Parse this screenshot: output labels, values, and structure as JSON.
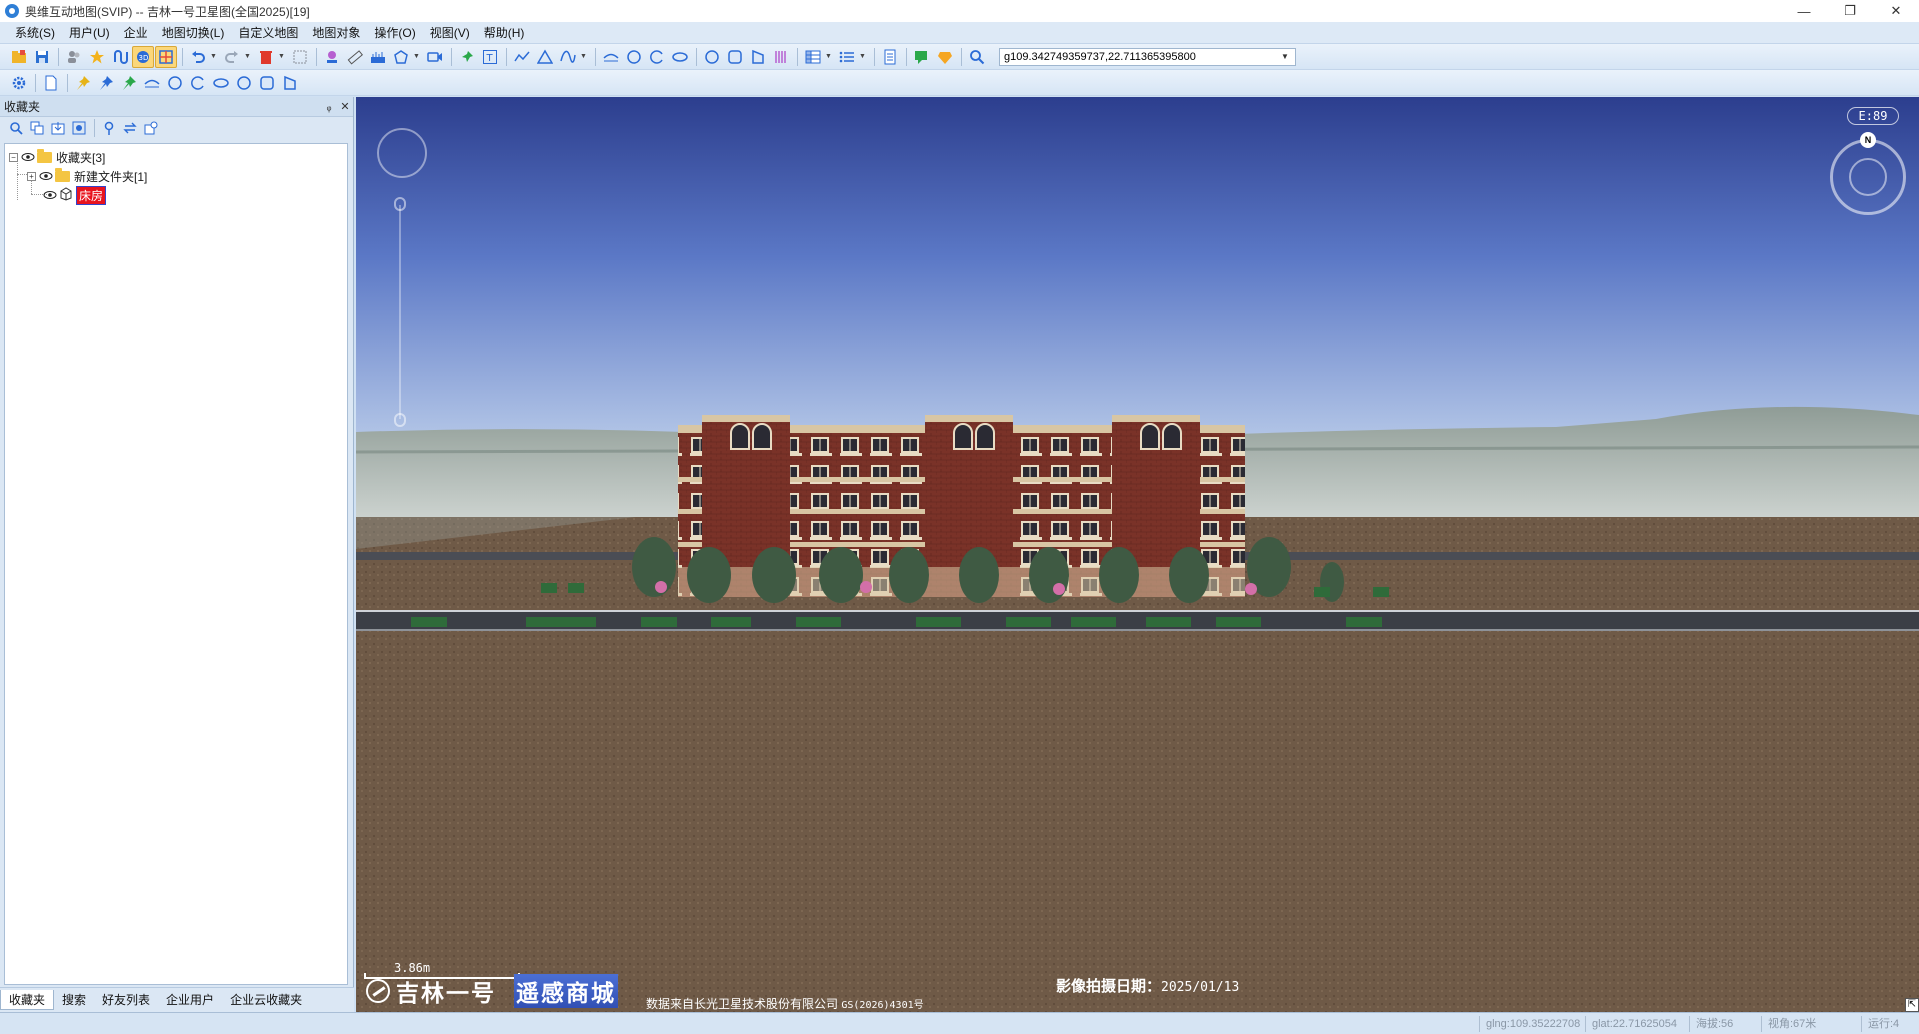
{
  "window": {
    "title": "奥维互动地图(SVIP) -- 吉林一号卫星图(全国2025)[19]",
    "controls": [
      "—",
      "❐",
      "✕"
    ]
  },
  "menu": [
    "系统(S)",
    "用户(U)",
    "企业",
    "地图切换(L)",
    "自定义地图",
    "地图对象",
    "操作(O)",
    "视图(V)",
    "帮助(H)"
  ],
  "toolbar": {
    "coordinates": "g109.342749359737,22.711365395800"
  },
  "left_panel": {
    "title": "收藏夹",
    "pin": "ᵩ",
    "close": "✕",
    "tree": {
      "root_label": "收藏夹[3]",
      "folder_label": "新建文件夹[1]",
      "item_label": "床房"
    },
    "tabs": [
      "收藏夹",
      "搜索",
      "好友列表",
      "企业用户",
      "企业云收藏夹"
    ]
  },
  "map": {
    "elevation": "E:89",
    "north": "N",
    "scale_label": "3.86m",
    "brand_name": "吉林一号",
    "brand_mall": "遥感商城",
    "credit": "数据来自长光卫星技术股份有限公司",
    "credit_gs": "GS(2026)4301号",
    "capture_label": "影像拍摄日期：",
    "capture_date": "2025/01/13",
    "grip": "⇱"
  },
  "status": {
    "lng": "glng:109.35222708",
    "lat": "glat:22.71625054",
    "altitude": "海拔:56",
    "view_angle": "视角:67米",
    "running": "运行:4"
  }
}
